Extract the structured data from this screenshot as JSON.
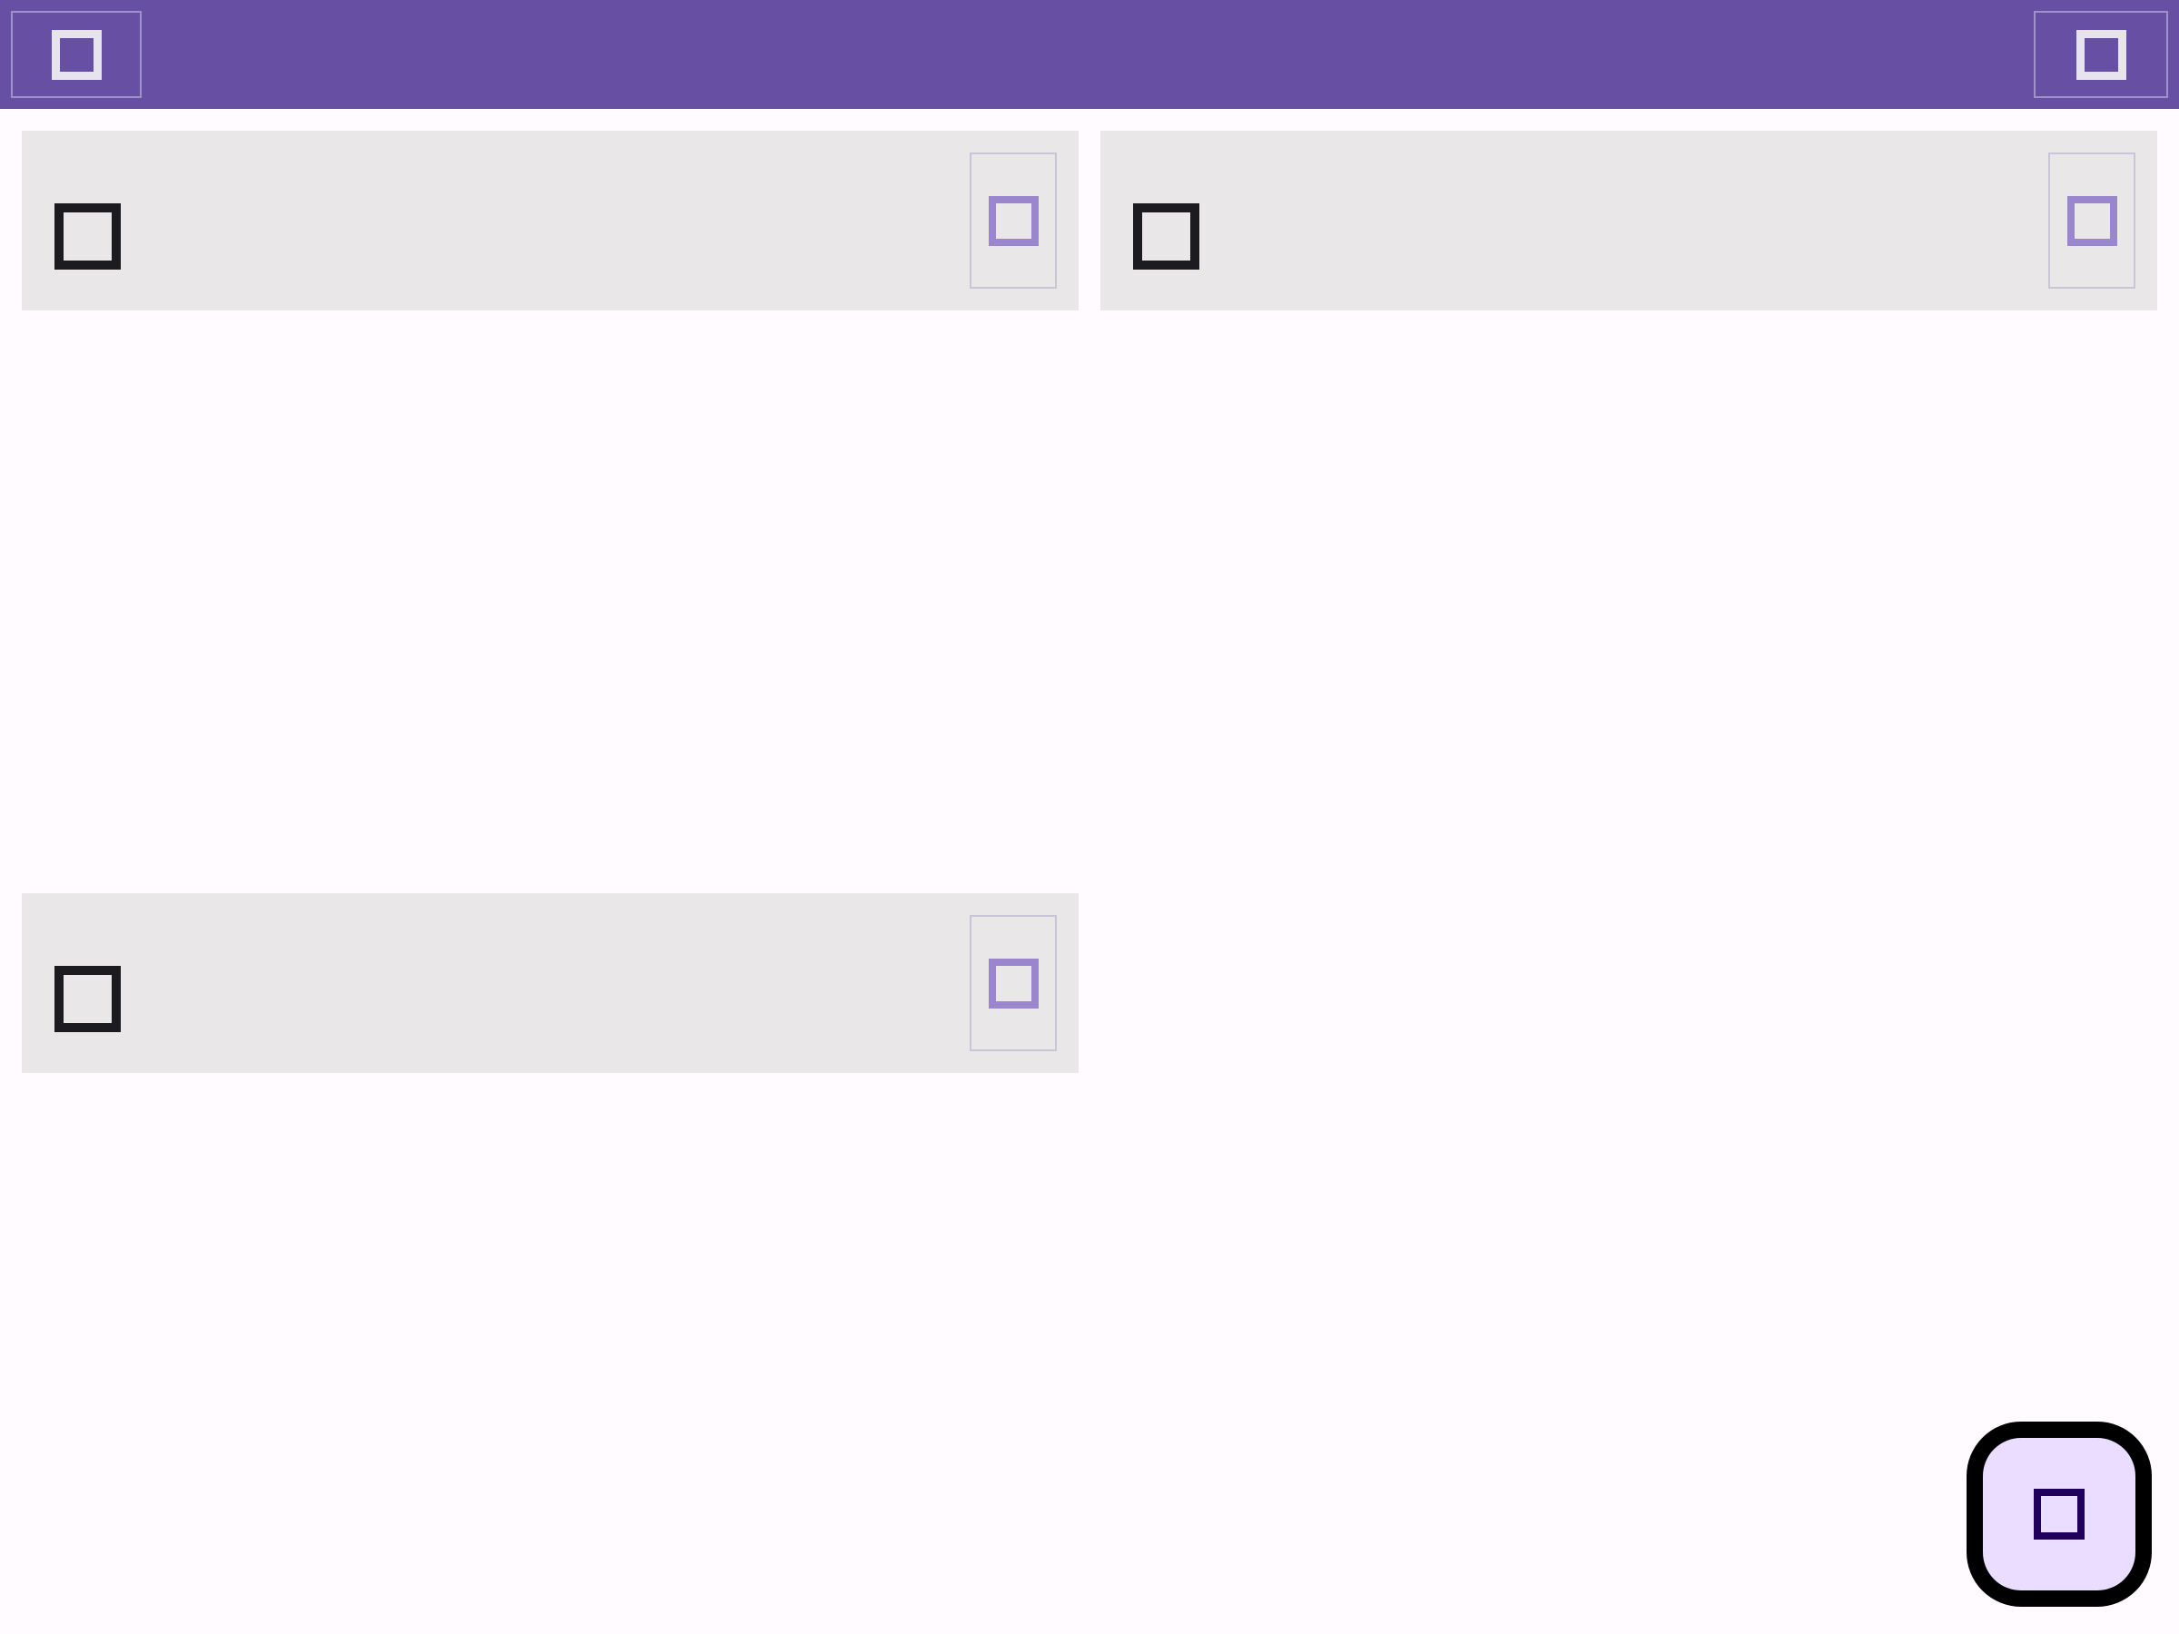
{
  "top_app_bar": {
    "navigation_icon": "menu-icon",
    "action_icon": "settings-icon",
    "background_color": "#6750a4"
  },
  "cards": [
    {
      "title": "",
      "amount": "",
      "leading_icon": "account-icon",
      "menu_icon": "more-vert-icon",
      "link_label": ""
    },
    {
      "title": "",
      "amount": "",
      "leading_icon": "account-icon",
      "menu_icon": "more-vert-icon",
      "link_label": ""
    },
    {
      "title": "",
      "amount": "",
      "leading_icon": "account-icon",
      "menu_icon": "more-vert-icon",
      "link_label": ""
    }
  ],
  "fab": {
    "icon": "add-icon",
    "background_color": "#eaddff"
  }
}
